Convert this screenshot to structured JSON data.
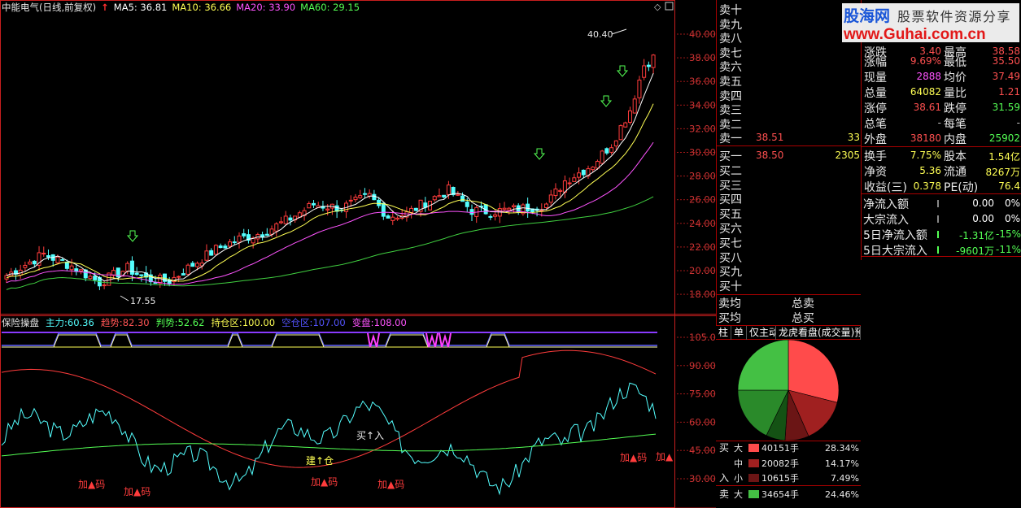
{
  "header": {
    "title": "中能电气(日线,前复权)",
    "arrow": "↑",
    "ma5": {
      "label": "MA5:",
      "value": "36.81",
      "color": "#ffffff"
    },
    "ma10": {
      "label": "MA10:",
      "value": "36.66",
      "color": "#ffff54"
    },
    "ma20": {
      "label": "MA20:",
      "value": "33.90",
      "color": "#ff54ff"
    },
    "ma60": {
      "label": "MA60:",
      "value": "29.15",
      "color": "#54ff54"
    }
  },
  "main_axis": {
    "labels": [
      "40.00",
      "38.00",
      "36.00",
      "34.00",
      "32.00",
      "30.00",
      "28.00",
      "26.00",
      "24.00",
      "22.00",
      "20.00",
      "18.00"
    ],
    "high_label": "40.40",
    "low_label": "17.55"
  },
  "indicator": {
    "title": "保险操盘",
    "items": [
      {
        "label": "主力:",
        "value": "60.36",
        "color": "#54ffff"
      },
      {
        "label": "趋势:",
        "value": "82.30",
        "color": "#ff5454"
      },
      {
        "label": "判势:",
        "value": "52.62",
        "color": "#54ff54"
      },
      {
        "label": "持仓区:",
        "value": "100.00",
        "color": "#ffff54"
      },
      {
        "label": "空仓区:",
        "value": "107.00",
        "color": "#5454ff"
      },
      {
        "label": "变盘:",
        "value": "108.00",
        "color": "#ff54ff"
      }
    ],
    "axis_labels": [
      "105.0",
      "90.00",
      "75.00",
      "60.00",
      "45.00",
      "30.00"
    ],
    "annotations": {
      "buy_in": "买↑入",
      "build": "建↑仓",
      "add1": "加▲码",
      "add2": "加▲码",
      "add3": "加▲码",
      "add4": "加▲码",
      "add5": "加▲码",
      "add6": "加▲"
    }
  },
  "order_book": {
    "sell": [
      "卖十",
      "卖九",
      "卖八",
      "卖七",
      "卖六",
      "卖五",
      "卖四",
      "卖三",
      "卖二",
      "卖一"
    ],
    "sell1_price": "38.51",
    "sell1_vol": "33",
    "buy": [
      "买一",
      "买二",
      "买三",
      "买四",
      "买五",
      "买六",
      "买七",
      "买八",
      "买九",
      "买十"
    ],
    "buy1_price": "38.50",
    "buy1_vol": "2305"
  },
  "avg": {
    "sell_avg": "卖均",
    "buy_avg": "买均",
    "total_sell": "总卖",
    "total_buy": "总买"
  },
  "quote": [
    {
      "l1": "涨跌",
      "v1": "3.40",
      "c1": "#ff5050",
      "l2": "最高",
      "v2": "38.58",
      "c2": "#ff5050"
    },
    {
      "l1": "涨幅",
      "v1": "9.69%",
      "c1": "#ff5050",
      "l2": "最低",
      "v2": "35.50",
      "c2": "#ff5050"
    },
    {
      "l1": "现量",
      "v1": "2888",
      "c1": "#ff54ff",
      "l2": "均价",
      "v2": "37.49",
      "c2": "#ff5050"
    },
    {
      "l1": "总量",
      "v1": "64082",
      "c1": "#ffff54",
      "l2": "量比",
      "v2": "1.21",
      "c2": "#ff5050"
    },
    {
      "l1": "涨停",
      "v1": "38.61",
      "c1": "#ff5050",
      "l2": "跌停",
      "v2": "31.59",
      "c2": "#54ff54"
    },
    {
      "l1": "总笔",
      "v1": "-",
      "c1": "#c8c8c8",
      "l2": "每笔",
      "v2": "-",
      "c2": "#c8c8c8"
    },
    {
      "l1": "外盘",
      "v1": "38180",
      "c1": "#ff5050",
      "l2": "内盘",
      "v2": "25902",
      "c2": "#54ff54"
    },
    {
      "l1": "换手",
      "v1": "7.75%",
      "c1": "#ffff54",
      "l2": "股本",
      "v2": "1.54亿",
      "c2": "#ffff54"
    },
    {
      "l1": "净资",
      "v1": "5.36",
      "c1": "#ffff54",
      "l2": "流通",
      "v2": "8267万",
      "c2": "#ffff54"
    },
    {
      "l1": "收益(三)",
      "v1": "0.378",
      "c1": "#ffff54",
      "l2": "PE(动)",
      "v2": "76.4",
      "c2": "#ffff54"
    }
  ],
  "flow": [
    {
      "label": "净流入额",
      "value": "0.00",
      "pct": "0%",
      "color": "#ffffff"
    },
    {
      "label": "大宗流入",
      "value": "0.00",
      "pct": "0%",
      "color": "#ffffff"
    },
    {
      "label": "5日净流入额",
      "value": "-1.31亿",
      "pct": "-15%",
      "color": "#54ff54"
    },
    {
      "label": "5日大宗流入",
      "value": "-9601万",
      "pct": "-11%",
      "color": "#54ff54"
    }
  ],
  "tabs": [
    "柱",
    "单",
    "仅主动",
    "龙虎看盘(成交量)预"
  ],
  "pie": {
    "slices": [
      {
        "name": "买大",
        "pct": 28.34,
        "color": "#ff4b4b"
      },
      {
        "name": "买中",
        "pct": 14.17,
        "color": "#a02020"
      },
      {
        "name": "买小",
        "pct": 7.49,
        "color": "#6b1515"
      },
      {
        "name": "卖小",
        "pct": 6.0,
        "color": "#145214"
      },
      {
        "name": "卖中",
        "pct": 17.5,
        "color": "#2a8a2a"
      },
      {
        "name": "卖大",
        "pct": 24.46,
        "color": "#44c044"
      }
    ]
  },
  "legend": {
    "buy_side": "买",
    "buy_side2": "入",
    "sell_side": "卖",
    "rows": [
      {
        "size": "大",
        "vol": "40151手",
        "pct": "28.34%",
        "color": "#ff4b4b"
      },
      {
        "size": "中",
        "vol": "20082手",
        "pct": "14.17%",
        "color": "#a02020"
      },
      {
        "size": "小",
        "vol": "10615手",
        "pct": "7.49%",
        "color": "#6b1515"
      },
      {
        "size": "大",
        "vol": "34654手",
        "pct": "24.46%",
        "color": "#44c044"
      }
    ]
  },
  "logo": {
    "name": "股海网",
    "slogan": "股票软件资源分享",
    "url": "www.Guhai.com.cn"
  }
}
